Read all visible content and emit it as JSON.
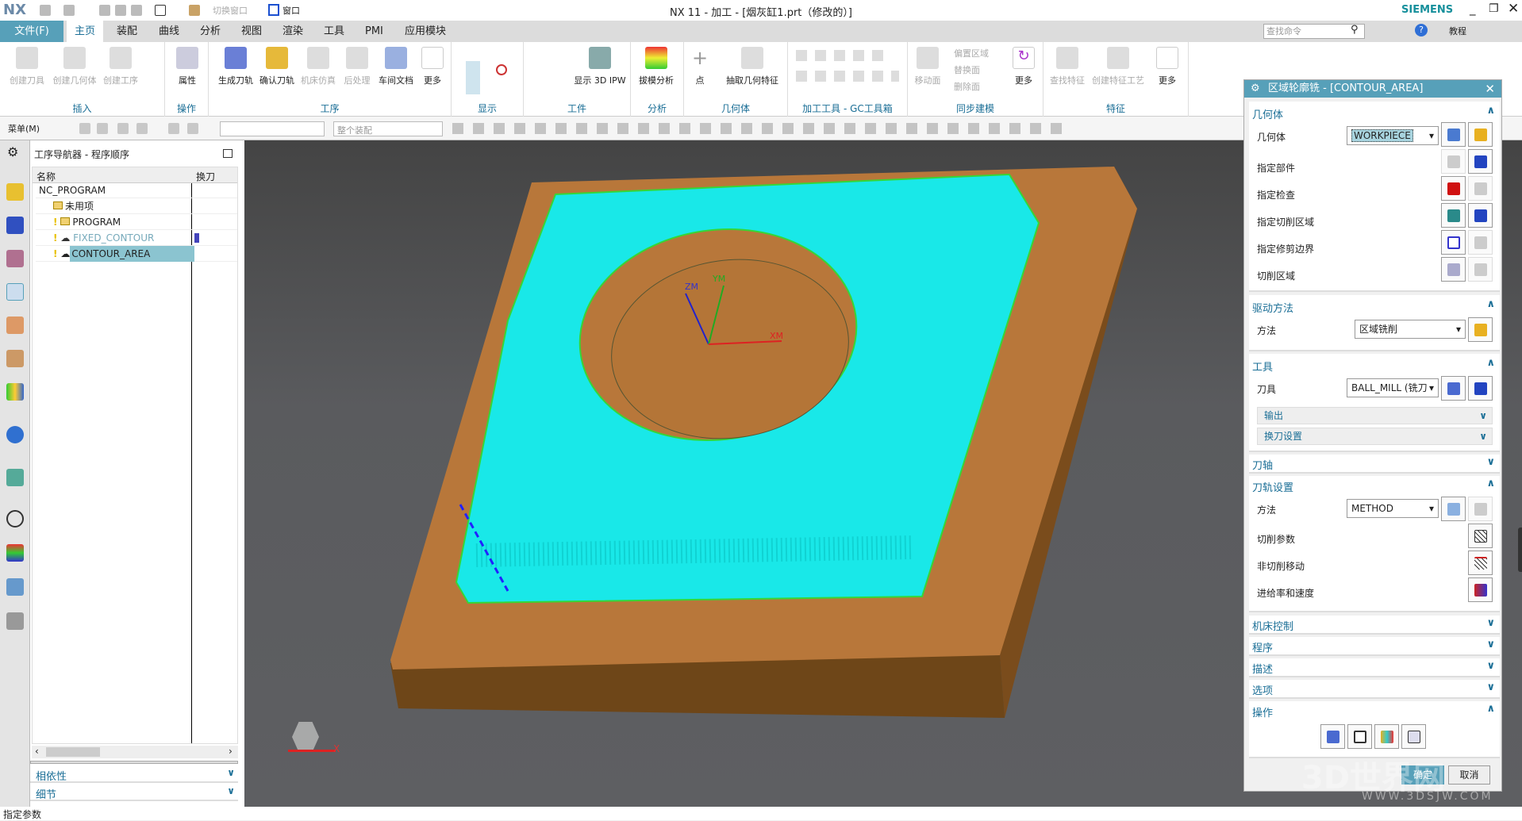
{
  "title_bar": {
    "logo": "NX",
    "title": "NX 11 - 加工 - [烟灰缸1.prt（修改的）]",
    "brand": "SIEMENS",
    "switch_window": "切换窗口",
    "window": "窗口"
  },
  "menu": {
    "tabs": [
      "文件(F)",
      "主页",
      "装配",
      "曲线",
      "分析",
      "视图",
      "渲染",
      "工具",
      "PMI",
      "应用模块"
    ],
    "active": "主页",
    "search_placeholder": "查找命令",
    "tutorial": "教程"
  },
  "ribbon": {
    "groups": [
      {
        "label": "插入",
        "buttons": [
          "创建刀具",
          "创建几何体",
          "创建工序"
        ]
      },
      {
        "label": "操作",
        "buttons": [
          "属性"
        ]
      },
      {
        "label": "工序",
        "buttons": [
          "生成刀轨",
          "确认刀轨",
          "机床仿真",
          "后处理",
          "车间文档",
          "更多"
        ]
      },
      {
        "label": "显示",
        "buttons": []
      },
      {
        "label": "工件",
        "buttons": [
          "显示 3D IPW"
        ]
      },
      {
        "label": "分析",
        "buttons": [
          "拔模分析"
        ]
      },
      {
        "label": "几何体",
        "buttons": [
          "点",
          "抽取几何特征"
        ]
      },
      {
        "label": "加工工具 - GC工具箱",
        "buttons": []
      },
      {
        "label": "同步建模",
        "buttons": [
          "移动面",
          "偏置区域",
          "替换面",
          "删除面",
          "更多"
        ]
      },
      {
        "label": "特征",
        "buttons": [
          "查找特征",
          "创建特征工艺",
          "更多"
        ]
      }
    ]
  },
  "toolbar": {
    "menu": "菜单(M)",
    "filter_value": "",
    "assembly_scope": "整个装配"
  },
  "navigator": {
    "title": "工序导航器 - 程序顺序",
    "columns": [
      "名称",
      "换刀"
    ],
    "rows": [
      {
        "name": "NC_PROGRAM",
        "level": 0
      },
      {
        "name": "未用项",
        "level": 1
      },
      {
        "name": "PROGRAM",
        "level": 1
      },
      {
        "name": "FIXED_CONTOUR",
        "level": 2,
        "muted": true
      },
      {
        "name": "CONTOUR_AREA",
        "level": 2,
        "selected": true
      }
    ],
    "panels": [
      "相依性",
      "细节"
    ]
  },
  "viewport": {
    "axis_labels": {
      "zm": "ZM",
      "ym": "YM",
      "xm": "XM"
    },
    "triad_x": "X",
    "colors": {
      "part": "#b8773a",
      "toolpath": "#19e8e8",
      "background": "#58595c"
    }
  },
  "dialog": {
    "title": "区域轮廓铣 - [CONTOUR_AREA]",
    "geometry": {
      "header": "几何体",
      "geometry_label": "几何体",
      "geometry_value": "WORKPIECE",
      "rows": [
        "指定部件",
        "指定检查",
        "指定切削区域",
        "指定修剪边界",
        "切削区域"
      ]
    },
    "drive": {
      "header": "驱动方法",
      "method_label": "方法",
      "method_value": "区域铣削"
    },
    "tool": {
      "header": "工具",
      "tool_label": "刀具",
      "tool_value": "BALL_MILL (铣刀",
      "output": "输出",
      "tool_change": "换刀设置"
    },
    "axis": {
      "header": "刀轴"
    },
    "path": {
      "header": "刀轨设置",
      "method_label": "方法",
      "method_value": "METHOD",
      "rows": [
        "切削参数",
        "非切削移动",
        "进给率和速度"
      ]
    },
    "collapsed": [
      "机床控制",
      "程序",
      "描述",
      "选项"
    ],
    "actions": {
      "header": "操作"
    },
    "ok": "确定",
    "cancel": "取消"
  },
  "watermark": {
    "text": "3D世界网",
    "url": "WWW.3DSJW.COM"
  },
  "status": {
    "text": "指定参数"
  }
}
